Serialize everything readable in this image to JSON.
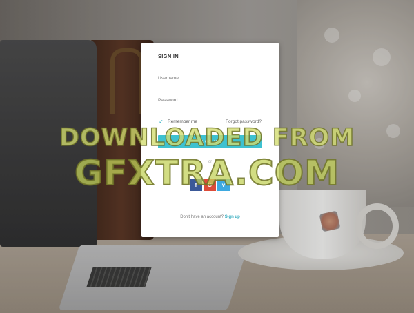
{
  "form": {
    "title": "SIGN IN",
    "username_placeholder": "Username",
    "password_placeholder": "Password",
    "remember_label": "Remember me",
    "remember_checked": true,
    "forgot_label": "Forgot password?",
    "login_label": "LOGIN",
    "or_label": "or",
    "social": [
      {
        "name": "facebook",
        "glyph": "f",
        "color": "#3b5998"
      },
      {
        "name": "google",
        "glyph": "G",
        "color": "#dd4b39"
      },
      {
        "name": "vimeo",
        "glyph": "v",
        "color": "#3ea9e0"
      }
    ],
    "signup_prompt": "Don't have an account?",
    "signup_link": "Sign up"
  },
  "colors": {
    "accent": "#3ec1d0",
    "link": "#2ea9bd"
  },
  "watermark": {
    "line1": "DOWNLOADED FROM",
    "line2": "GFXTRA.COM"
  }
}
